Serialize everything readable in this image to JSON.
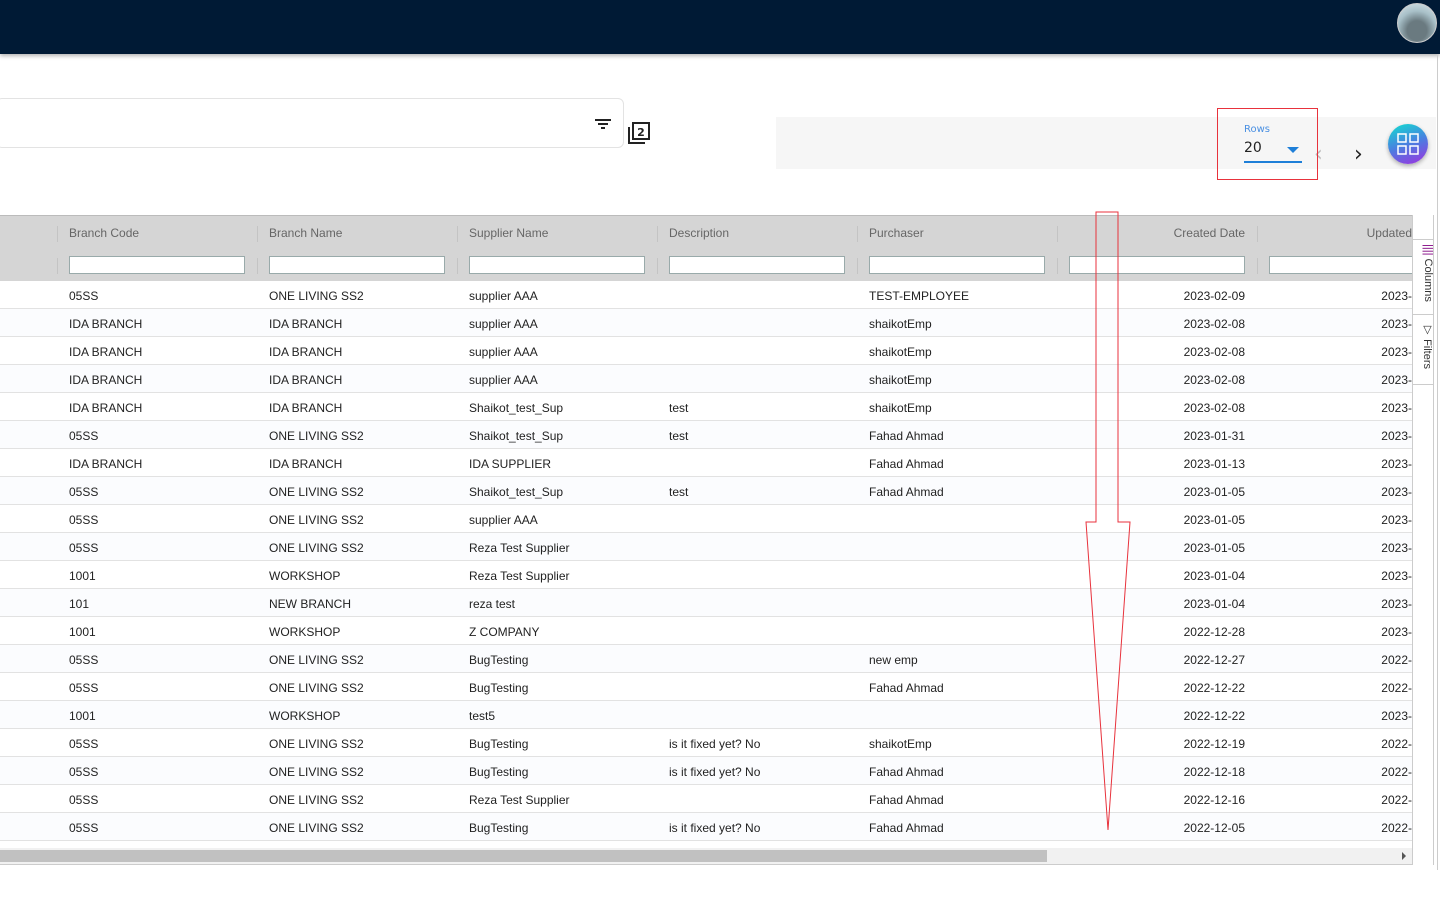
{
  "header": {
    "avatar": "user-avatar"
  },
  "toolbar": {
    "rows_label": "Rows",
    "rows_value": "20",
    "prev": "‹",
    "next": "›"
  },
  "grid": {
    "columns": [
      "Branch Code",
      "Branch Name",
      "Supplier Name",
      "Description",
      "Purchaser",
      "Created Date",
      "Updated"
    ],
    "rows": [
      [
        "05SS",
        "ONE LIVING SS2",
        "supplier AAA",
        "",
        "TEST-EMPLOYEE",
        "2023-02-09",
        "2023-"
      ],
      [
        "IDA BRANCH",
        "IDA BRANCH",
        "supplier AAA",
        "",
        "shaikotEmp",
        "2023-02-08",
        "2023-"
      ],
      [
        "IDA BRANCH",
        "IDA BRANCH",
        "supplier AAA",
        "",
        "shaikotEmp",
        "2023-02-08",
        "2023-"
      ],
      [
        "IDA BRANCH",
        "IDA BRANCH",
        "supplier AAA",
        "",
        "shaikotEmp",
        "2023-02-08",
        "2023-"
      ],
      [
        "IDA BRANCH",
        "IDA BRANCH",
        "Shaikot_test_Sup",
        "test",
        "shaikotEmp",
        "2023-02-08",
        "2023-"
      ],
      [
        "05SS",
        "ONE LIVING SS2",
        "Shaikot_test_Sup",
        "test",
        "Fahad Ahmad",
        "2023-01-31",
        "2023-"
      ],
      [
        "IDA BRANCH",
        "IDA BRANCH",
        "IDA SUPPLIER",
        "",
        "Fahad Ahmad",
        "2023-01-13",
        "2023-"
      ],
      [
        "05SS",
        "ONE LIVING SS2",
        "Shaikot_test_Sup",
        "test",
        "Fahad Ahmad",
        "2023-01-05",
        "2023-"
      ],
      [
        "05SS",
        "ONE LIVING SS2",
        "supplier AAA",
        "",
        "",
        "2023-01-05",
        "2023-"
      ],
      [
        "05SS",
        "ONE LIVING SS2",
        "Reza Test Supplier",
        "",
        "",
        "2023-01-05",
        "2023-"
      ],
      [
        "1001",
        "WORKSHOP",
        "Reza Test Supplier",
        "",
        "",
        "2023-01-04",
        "2023-"
      ],
      [
        "101",
        "NEW BRANCH",
        "reza test",
        "",
        "",
        "2023-01-04",
        "2023-"
      ],
      [
        "1001",
        "WORKSHOP",
        "Z COMPANY",
        "",
        "",
        "2022-12-28",
        "2023-"
      ],
      [
        "05SS",
        "ONE LIVING SS2",
        "BugTesting",
        "",
        "new emp",
        "2022-12-27",
        "2022-"
      ],
      [
        "05SS",
        "ONE LIVING SS2",
        "BugTesting",
        "",
        "Fahad Ahmad",
        "2022-12-22",
        "2022-"
      ],
      [
        "1001",
        "WORKSHOP",
        "test5",
        "",
        "",
        "2022-12-22",
        "2023-"
      ],
      [
        "05SS",
        "ONE LIVING SS2",
        "BugTesting",
        "is it fixed yet? No",
        "shaikotEmp",
        "2022-12-19",
        "2022-"
      ],
      [
        "05SS",
        "ONE LIVING SS2",
        "BugTesting",
        "is it fixed yet? No",
        "Fahad Ahmad",
        "2022-12-18",
        "2022-"
      ],
      [
        "05SS",
        "ONE LIVING SS2",
        "Reza Test Supplier",
        "",
        "Fahad Ahmad",
        "2022-12-16",
        "2022-"
      ],
      [
        "05SS",
        "ONE LIVING SS2",
        "BugTesting",
        "is it fixed yet? No",
        "Fahad Ahmad",
        "2022-12-05",
        "2022-"
      ]
    ]
  },
  "side_panel": {
    "columns": "Columns",
    "filters": "Filters"
  },
  "colors": {
    "topbar": "#001a35",
    "accent": "#1e7fd8",
    "annotation": "#e8323c"
  }
}
